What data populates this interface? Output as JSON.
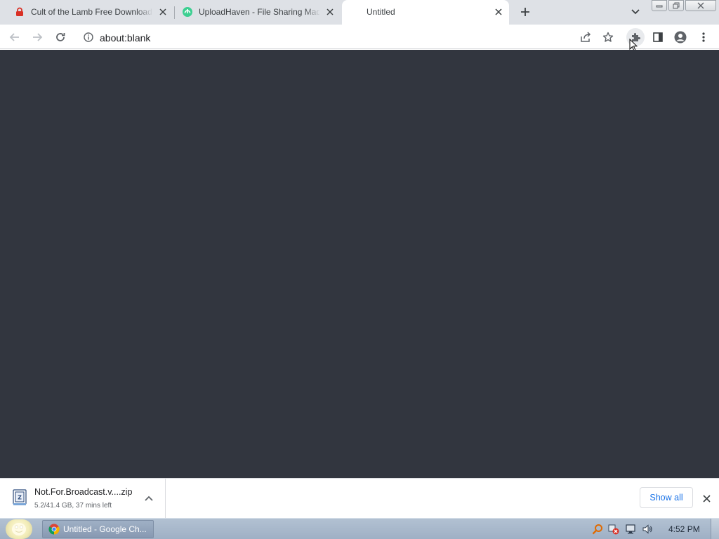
{
  "browser": {
    "tabs": [
      {
        "title": "Cult of the Lamb Free Download",
        "favicon": "red-lock-icon",
        "active": false
      },
      {
        "title": "UploadHaven - File Sharing Made",
        "favicon": "uploadhaven-icon",
        "active": false
      },
      {
        "title": "Untitled",
        "favicon": "",
        "active": true
      }
    ],
    "new_tab_icon": "plus-icon",
    "tab_search_icon": "chevron-down-icon"
  },
  "toolbar": {
    "url": "about:blank",
    "icons": [
      "back-icon",
      "forward-icon",
      "reload-icon",
      "info-icon",
      "share-icon",
      "star-icon",
      "extensions-icon",
      "side-panel-icon",
      "profile-icon",
      "menu-icon"
    ]
  },
  "content": {
    "background": "#32363f"
  },
  "download_shelf": {
    "filename": "Not.For.Broadcast.v....zip",
    "status": "5.2/41.4 GB, 37 mins left",
    "show_all_label": "Show all"
  },
  "taskbar": {
    "window_label": "Untitled - Google Ch...",
    "clock": "4:52 PM",
    "tray_icons": [
      "search-tray-icon",
      "network-error-icon",
      "monitor-icon",
      "volume-icon"
    ]
  },
  "colors": {
    "tabstrip": "#dee1e6",
    "content": "#32363f",
    "link_blue": "#1a73e8",
    "taskbar": "#a9b8ca"
  }
}
